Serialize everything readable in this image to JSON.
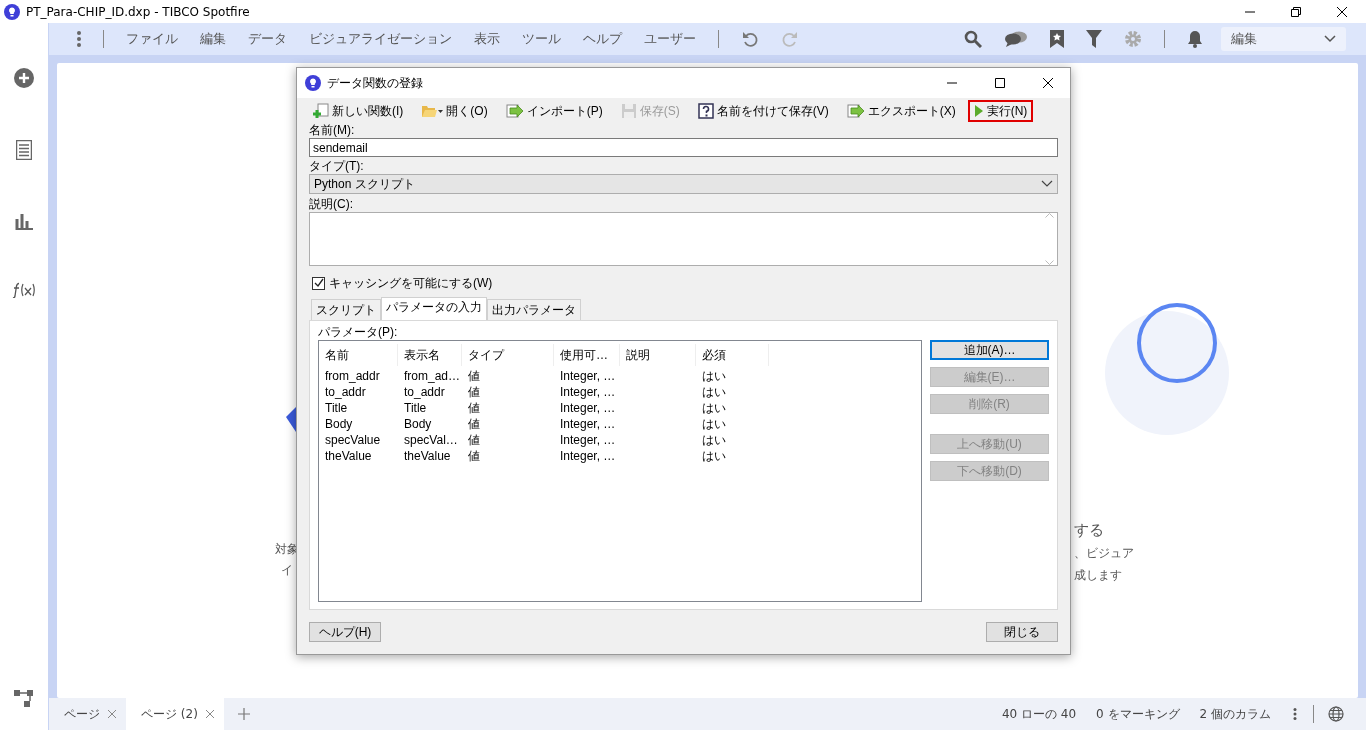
{
  "window": {
    "title": "PT_Para-CHIP_ID.dxp - TIBCO Spotfire"
  },
  "menu": [
    "ファイル",
    "編集",
    "データ",
    "ビジュアライゼーション",
    "表示",
    "ツール",
    "ヘルプ",
    "ユーザー"
  ],
  "mode_select": {
    "value": "編集"
  },
  "background_text": {
    "left": [
      "対象",
      "イ"
    ],
    "right": [
      "する",
      "、ビジュア",
      "成します"
    ]
  },
  "dialog": {
    "title": "データ関数の登録",
    "toolbar": [
      {
        "label": "新しい関数(I)",
        "kind": "new",
        "disabled": false,
        "highlighted": false
      },
      {
        "label": "開く(O)",
        "kind": "open",
        "disabled": false,
        "highlighted": false
      },
      {
        "label": "インポート(P)",
        "kind": "import",
        "disabled": false,
        "highlighted": false
      },
      {
        "label": "保存(S)",
        "kind": "save",
        "disabled": true,
        "highlighted": false
      },
      {
        "label": "名前を付けて保存(V)",
        "kind": "saveas",
        "disabled": false,
        "highlighted": false
      },
      {
        "label": "エクスポート(X)",
        "kind": "export",
        "disabled": false,
        "highlighted": false
      },
      {
        "label": "実行(N)",
        "kind": "run",
        "disabled": false,
        "highlighted": true
      }
    ],
    "name_label": "名前(M):",
    "name_value": "sendemail",
    "type_label": "タイプ(T):",
    "type_value": "Python スクリプト",
    "description_label": "説明(C):",
    "caching": {
      "label": "キャッシングを可能にする(W)",
      "checked": true
    },
    "tabs": [
      {
        "label": "スクリプト",
        "selected": false
      },
      {
        "label": "パラメータの入力",
        "selected": true
      },
      {
        "label": "出力パラメータ",
        "selected": false
      }
    ],
    "parameters_label": "パラメータ(P):",
    "table": {
      "columns": [
        "名前",
        "表示名",
        "タイプ",
        "使用可…",
        "説明",
        "必須"
      ],
      "rows": [
        [
          "from_addr",
          "from_ad…",
          "値",
          "Integer, …",
          "",
          "はい"
        ],
        [
          "to_addr",
          "to_addr",
          "値",
          "Integer, …",
          "",
          "はい"
        ],
        [
          "Title",
          "Title",
          "値",
          "Integer, …",
          "",
          "はい"
        ],
        [
          "Body",
          "Body",
          "値",
          "Integer, …",
          "",
          "はい"
        ],
        [
          "specValue",
          "specVal…",
          "値",
          "Integer, …",
          "",
          "はい"
        ],
        [
          "theValue",
          "theValue",
          "値",
          "Integer, …",
          "",
          "はい"
        ]
      ]
    },
    "side_buttons": [
      {
        "label": "追加(A)…",
        "disabled": false
      },
      {
        "label": "編集(E)…",
        "disabled": true
      },
      {
        "label": "削除(R)",
        "disabled": true
      },
      {
        "label": "上へ移動(U)",
        "disabled": true
      },
      {
        "label": "下へ移動(D)",
        "disabled": true
      }
    ],
    "help_button": "ヘルプ(H)",
    "close_button": "閉じる"
  },
  "page_tabs": [
    {
      "label": "ページ",
      "selected": false
    },
    {
      "label": "ページ (2)",
      "selected": true
    }
  ],
  "status_bar": [
    "40 ローの 40",
    "0 をマーキング",
    "2 個のカラム"
  ]
}
